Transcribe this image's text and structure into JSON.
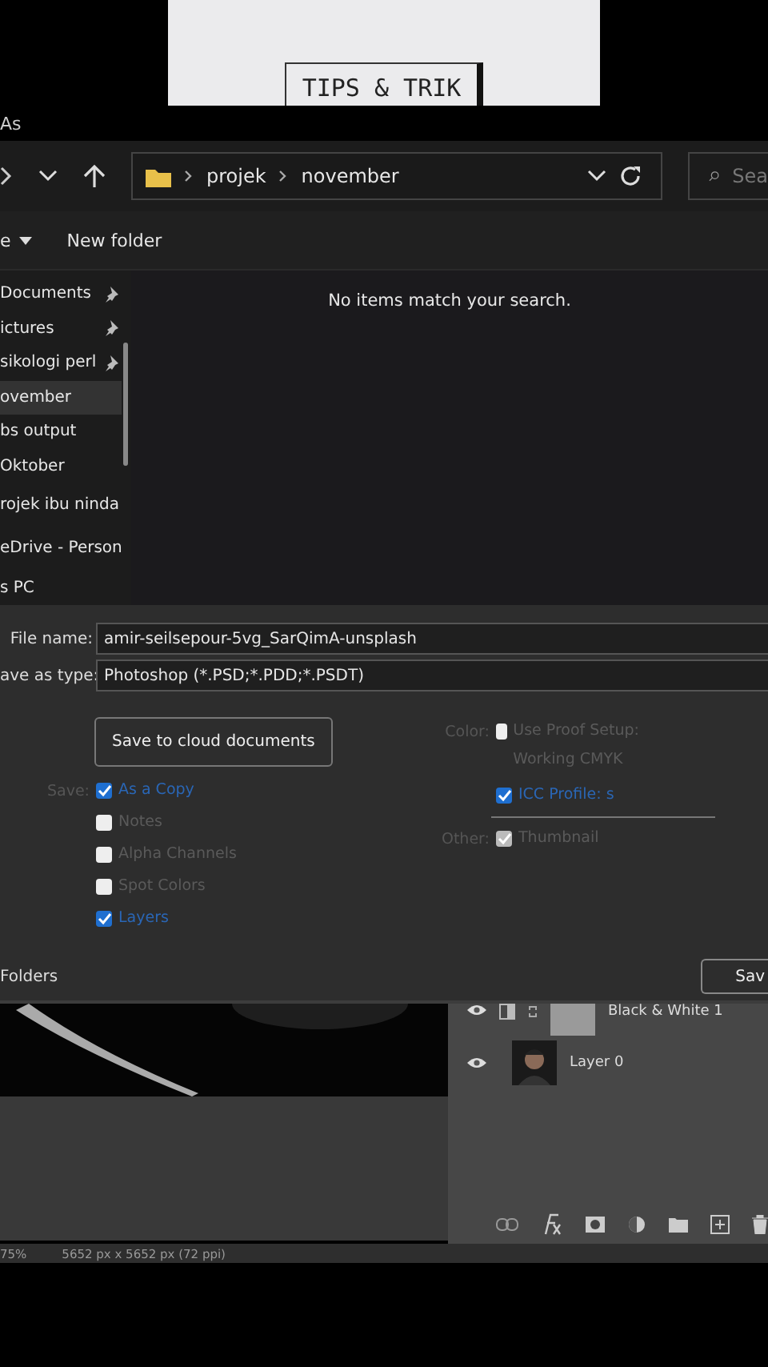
{
  "banner": {
    "title": "TIPS & TRIK"
  },
  "window": {
    "title": "As"
  },
  "address_bar": {
    "path": [
      "projek",
      "november"
    ],
    "search_placeholder": "Sea"
  },
  "toolbar": {
    "menu": "e",
    "new_folder": "New folder"
  },
  "nav": [
    {
      "label": "Documents",
      "pinned": true,
      "selected": false
    },
    {
      "label": "ictures",
      "pinned": true,
      "selected": false
    },
    {
      "label": "sikologi perl",
      "pinned": true,
      "selected": false
    },
    {
      "label": "ovember",
      "pinned": false,
      "selected": true
    },
    {
      "label": "bs output",
      "pinned": false,
      "selected": false
    },
    {
      "label": "Oktober",
      "pinned": false,
      "selected": false
    },
    {
      "label": "rojek ibu ninda",
      "pinned": false,
      "selected": false
    },
    {
      "label": "eDrive - Person",
      "pinned": false,
      "selected": false
    },
    {
      "label": "s PC",
      "pinned": false,
      "selected": false
    }
  ],
  "empty_message": "No items match your search.",
  "file_name": {
    "label": "File name:",
    "value": "amir-seilsepour-5vg_SarQimA-unsplash"
  },
  "save_type": {
    "label": "ave as type:",
    "value": "Photoshop (*.PSD;*.PDD;*.PSDT)"
  },
  "cloud_button": "Save to cloud documents",
  "save_options": {
    "label": "Save:",
    "items": [
      {
        "label": "As a Copy",
        "checked": true
      },
      {
        "label": "Notes",
        "checked": false
      },
      {
        "label": "Alpha Channels",
        "checked": false
      },
      {
        "label": "Spot Colors",
        "checked": false
      },
      {
        "label": "Layers",
        "checked": true
      }
    ]
  },
  "color_options": {
    "label": "Color:",
    "items": [
      {
        "label": "Use Proof Setup: Working CMYK",
        "checked": false
      },
      {
        "label": "ICC Profile: s",
        "checked": true
      }
    ]
  },
  "other_options": {
    "label": "Other:",
    "items": [
      {
        "label": "Thumbnail",
        "checked": true,
        "disabled": true
      }
    ]
  },
  "folders_toggle": "Folders",
  "save_button": "Sav",
  "layers": [
    {
      "name": "Black & White 1",
      "kind": "adjustment"
    },
    {
      "name": "Layer 0"
    }
  ],
  "status_bar": {
    "zoom": "75%",
    "size": "5652 px x 5652 px (72 ppi)"
  }
}
